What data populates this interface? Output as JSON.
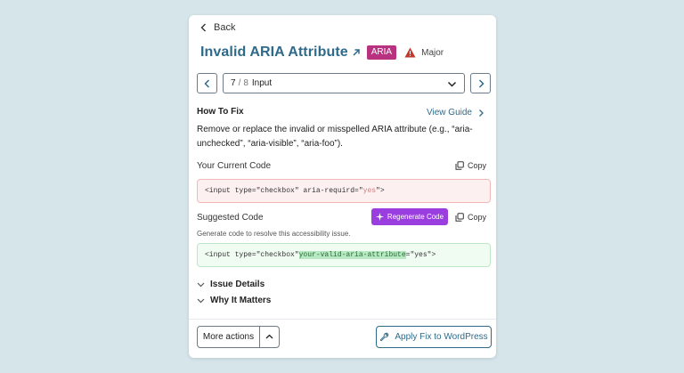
{
  "header": {
    "back_label": "Back",
    "title": "Invalid ARIA Attribute",
    "badge": "ARIA",
    "severity": "Major"
  },
  "navigator": {
    "current": "7",
    "separator": "/",
    "total": "8",
    "label": "Input"
  },
  "how_to_fix": {
    "heading": "How To Fix",
    "view_guide_label": "View Guide",
    "description": "Remove or replace the invalid or misspelled ARIA attribute (e.g., “aria-unchecked”, “aria-visible”, “aria-foo”)."
  },
  "current_code": {
    "label": "Your Current Code",
    "copy_label": "Copy",
    "prefix": "<input type=\"checkbox\" aria-requird=\"",
    "highlight": "yes",
    "suffix": "\">"
  },
  "suggested_code": {
    "label": "Suggested Code",
    "regenerate_label": "Regenerate Code",
    "copy_label": "Copy",
    "description": "Generate code to resolve this accessibility issue.",
    "prefix": "<input type=\"checkbox\" ",
    "highlight": "your-valid-aria-attribute",
    "suffix": "=\"yes\">"
  },
  "sections": {
    "issue_details": "Issue Details",
    "why_it_matters": "Why It Matters"
  },
  "footer": {
    "more_actions_label": "More actions",
    "apply_label": "Apply Fix to WordPress"
  },
  "colors": {
    "accent": "#2e6b8a",
    "badge": "#b83280",
    "regenerate": "#9a3ee0",
    "warning": "#c0392b",
    "background": "#d5e5ea"
  }
}
